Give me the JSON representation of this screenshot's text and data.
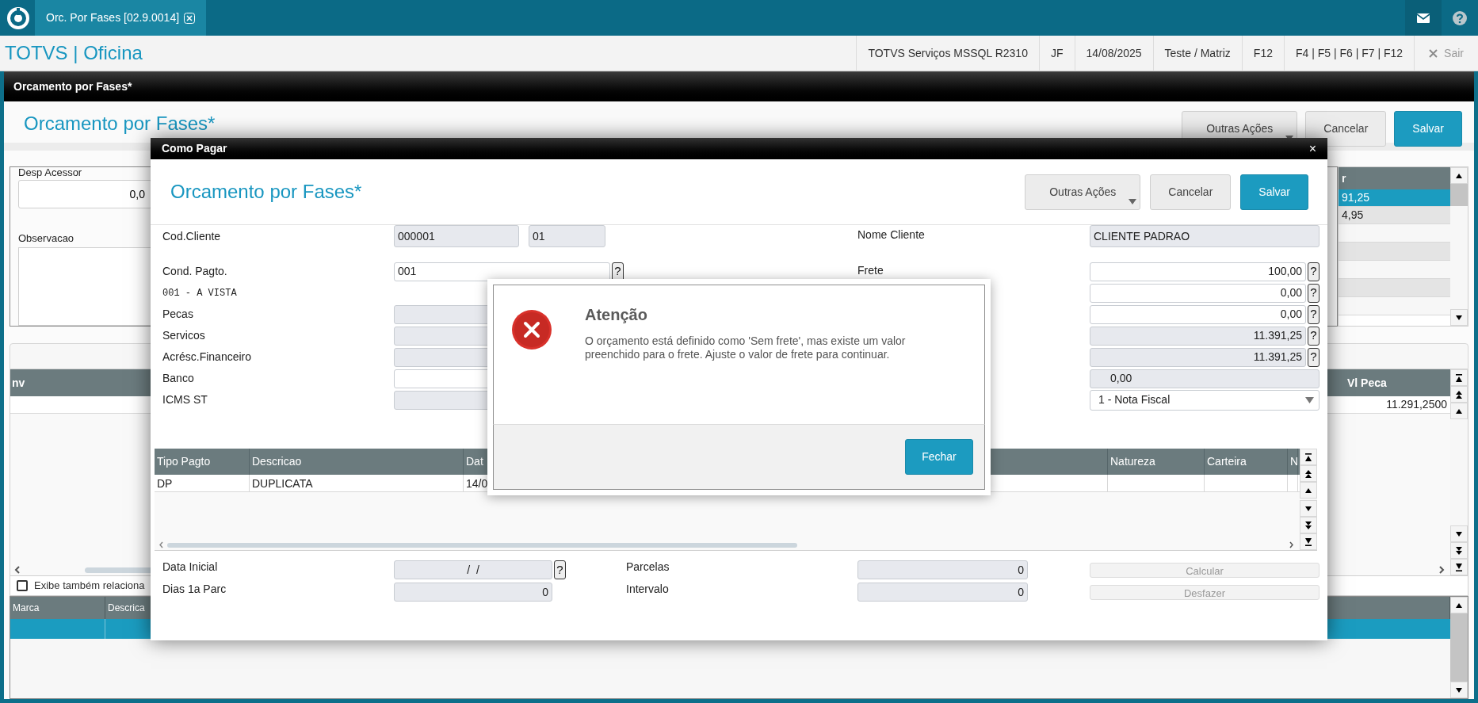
{
  "top_bar": {
    "tabs": [
      {
        "label": "Orc. Por Fases [02.9.0014]",
        "selected": true
      }
    ]
  },
  "header": {
    "app_title": "TOTVS | Oficina",
    "info": [
      "TOTVS Serviços MSSQL R2310",
      "JF",
      "14/08/2025",
      "Teste / Matriz",
      "F12",
      "F4 | F5 | F6 | F7 | F12"
    ],
    "exit": {
      "label": "Sair",
      "disabled": true
    }
  },
  "page": {
    "title_bar": "Orcamento por Fases*",
    "title": "Orcamento por Fases*",
    "buttons": [
      {
        "label": "Outras Ações",
        "kind": "menu"
      },
      {
        "label": "Cancelar",
        "kind": "default"
      },
      {
        "label": "Salvar",
        "kind": "primary"
      }
    ],
    "desp_acessor": {
      "label": "Desp Acessor",
      "value": "0,0"
    },
    "observacao": {
      "label": "Observacao"
    },
    "totals_table": {
      "column_1": "r",
      "rows": [
        {
          "value": "91,25",
          "selected": true
        },
        {
          "value": "4,95",
          "selected": false
        }
      ]
    },
    "items_table": {
      "columns": [
        "nv",
        "Vl Peca"
      ],
      "rows": [
        {
          "vl_peca": "11.291,2500"
        }
      ]
    },
    "show_related": {
      "label": "Exibe também relaciona",
      "checked": false
    },
    "brands_table": {
      "columns": [
        "Marca",
        "Descrica"
      ],
      "rows": [
        {
          "selected": true
        }
      ]
    }
  },
  "dialog": {
    "title": "Como Pagar",
    "close": "×",
    "heading": "Orcamento por Fases*",
    "buttons": [
      {
        "label": "Outras Ações",
        "kind": "menu"
      },
      {
        "label": "Cancelar",
        "kind": "default"
      },
      {
        "label": "Salvar",
        "kind": "primary"
      }
    ],
    "form_rows": [
      {
        "label": "Cod.Cliente",
        "kind": "fields",
        "fields": [
          {
            "value": "000001",
            "editable": false
          },
          {
            "value": "01",
            "editable": false
          }
        ],
        "right": {
          "label": "Nome Cliente",
          "kind": "text",
          "value": "CLIENTE PADRAO",
          "editable": false
        }
      },
      {
        "label": "Cond. Pagto.",
        "kind": "fields",
        "fields": [
          {
            "value": "001",
            "editable": true,
            "help": "?"
          }
        ],
        "right": {
          "label": "Frete",
          "kind": "number",
          "value": "100,00",
          "editable": true,
          "help": "?"
        }
      },
      {
        "label": "001 - A VISTA",
        "kind": "note",
        "right": {
          "kind": "number",
          "value": "0,00",
          "editable": true,
          "help": "?"
        }
      },
      {
        "label": "Pecas",
        "kind": "fields",
        "fields": [
          {
            "editable": false
          }
        ],
        "right": {
          "kind": "number",
          "value": "0,00",
          "editable": true,
          "help": "?"
        }
      },
      {
        "label": "Servicos",
        "kind": "fields",
        "fields": [
          {
            "editable": false
          }
        ],
        "right": {
          "kind": "number",
          "value": "11.391,25",
          "editable": false,
          "help": "?"
        }
      },
      {
        "label": "Acrésc.Financeiro",
        "kind": "fields",
        "fields": [
          {
            "editable": false
          }
        ],
        "right": {
          "kind": "number",
          "value": "11.391,25",
          "editable": false,
          "help": "?"
        }
      },
      {
        "label": "Banco",
        "kind": "fields",
        "fields": [
          {
            "editable": true
          }
        ],
        "right": {
          "kind": "text",
          "value": "0,00",
          "editable": false
        }
      },
      {
        "label": "ICMS ST",
        "kind": "fields",
        "fields": [
          {
            "editable": false
          }
        ],
        "right": {
          "kind": "select",
          "value": "1 - Nota Fiscal",
          "editable": true
        }
      }
    ],
    "payments_table": {
      "columns": [
        "Tipo Pagto",
        "Descricao",
        "Dat",
        "Natureza",
        "Carteira",
        "N"
      ],
      "rows": [
        {
          "cells": [
            "DP",
            "DUPLICATA",
            "14/0"
          ]
        }
      ]
    },
    "bottom_rows": [
      {
        "label": "Data Inicial",
        "field": {
          "value": "/  /",
          "editable": false,
          "help": "?"
        },
        "label_2": "Parcelas",
        "field_2": {
          "value": "0",
          "editable": false
        },
        "button": {
          "label": "Calcular",
          "disabled": true
        }
      },
      {
        "label": "Dias 1a Parc",
        "field": {
          "value": "0",
          "editable": false
        },
        "label_2": "Intervalo",
        "field_2": {
          "value": "0",
          "editable": false
        },
        "button": {
          "label": "Desfazer",
          "disabled": true
        }
      }
    ]
  },
  "alert": {
    "kind": "error",
    "title": "Atenção",
    "message": "O orçamento está definido como 'Sem frete', mas existe um valor preenchido para o frete. Ajuste o valor de frete para continuar.",
    "button": "Fechar"
  }
}
